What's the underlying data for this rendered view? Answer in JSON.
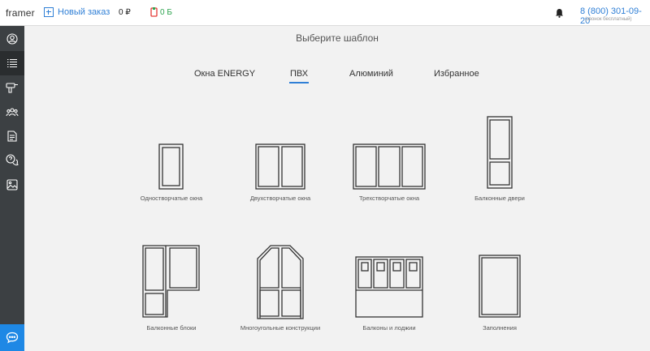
{
  "header": {
    "logo": "framer",
    "new_order_label": "Новый заказ",
    "balance": "0 ₽",
    "bonus": "0 Б",
    "phone": "8 (800) 301-09-20",
    "phone_note": "(звонок бесплатный)"
  },
  "sidebar": {
    "items": [
      {
        "icon": "user-icon"
      },
      {
        "icon": "list-icon"
      },
      {
        "icon": "drill-icon"
      },
      {
        "icon": "users-icon"
      },
      {
        "icon": "document-icon"
      },
      {
        "icon": "help-chat-icon"
      },
      {
        "icon": "image-icon"
      }
    ],
    "active_index": 1,
    "chat_icon": "chat-icon"
  },
  "main": {
    "heading": "Выберите шаблон",
    "tabs": [
      {
        "label": "Окна ENERGY"
      },
      {
        "label": "ПВХ"
      },
      {
        "label": "Алюминий"
      },
      {
        "label": "Избранное"
      }
    ],
    "active_tab": "ПВХ",
    "templates": [
      {
        "label": "Одностворчатые окна"
      },
      {
        "label": "Двухстворчатые окна"
      },
      {
        "label": "Трехстворчатые окна"
      },
      {
        "label": "Балконные двери"
      },
      {
        "label": "Балконные блоки"
      },
      {
        "label": "Многоугольные конструкции"
      },
      {
        "label": "Балконы и лоджии"
      },
      {
        "label": "Заполнения"
      }
    ]
  },
  "colors": {
    "accent": "#2f7fd6",
    "sidebar": "#3c4043",
    "chat_button": "#1e88e5",
    "bonus": "#2ea44f",
    "bonus_icon": "#e53935"
  }
}
